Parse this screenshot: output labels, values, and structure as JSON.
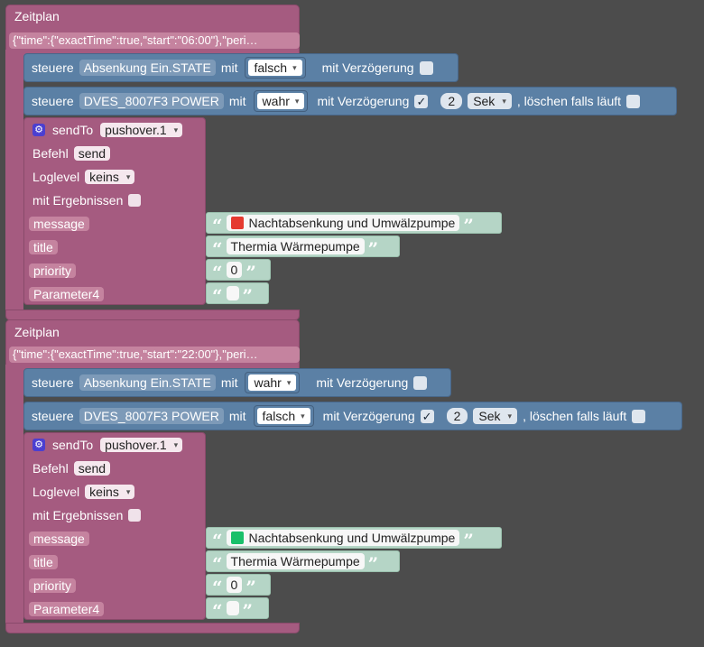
{
  "blocks": [
    {
      "title": "Zeitplan",
      "schedule_arg": "{\"time\":{\"exactTime\":true,\"start\":\"06:00\"},\"peri…",
      "ctrl1": {
        "steuere": "steuere",
        "object": "Absenkung Ein.STATE",
        "mit": "mit",
        "value": "falsch",
        "delay_label": "mit Verzögerung"
      },
      "ctrl2": {
        "steuere": "steuere",
        "object": "DVES_8007F3 POWER",
        "mit": "mit",
        "value": "wahr",
        "delay_label": "mit Verzögerung",
        "check": "✓",
        "delay_value": "2",
        "unit": "Sek",
        "clear_label": ", löschen falls läuft"
      },
      "send": {
        "label": "sendTo",
        "instance": "pushover.1",
        "befehl_label": "Befehl",
        "befehl_value": "send",
        "loglevel_label": "Loglevel",
        "loglevel_value": "keins",
        "ergebnis_label": "mit Ergebnissen",
        "message_label": "message",
        "message_text": "Nachtabsenkung und Umwälzpumpe",
        "message_color": "#e53a2f",
        "title_label": "title",
        "title_text": "Thermia Wärmepumpe",
        "priority_label": "priority",
        "priority_value": "0",
        "param4_label": "Parameter4"
      }
    },
    {
      "title": "Zeitplan",
      "schedule_arg": "{\"time\":{\"exactTime\":true,\"start\":\"22:00\"},\"peri…",
      "ctrl1": {
        "steuere": "steuere",
        "object": "Absenkung Ein.STATE",
        "mit": "mit",
        "value": "wahr",
        "delay_label": "mit Verzögerung"
      },
      "ctrl2": {
        "steuere": "steuere",
        "object": "DVES_8007F3 POWER",
        "mit": "mit",
        "value": "falsch",
        "delay_label": "mit Verzögerung",
        "check": "✓",
        "delay_value": "2",
        "unit": "Sek",
        "clear_label": ", löschen falls läuft"
      },
      "send": {
        "label": "sendTo",
        "instance": "pushover.1",
        "befehl_label": "Befehl",
        "befehl_value": "send",
        "loglevel_label": "Loglevel",
        "loglevel_value": "keins",
        "ergebnis_label": "mit Ergebnissen",
        "message_label": "message",
        "message_text": "Nachtabsenkung und Umwälzpumpe",
        "message_color": "#19c06a",
        "title_label": "title",
        "title_text": "Thermia Wärmepumpe",
        "priority_label": "priority",
        "priority_value": "0",
        "param4_label": "Parameter4"
      }
    }
  ],
  "icons": {
    "caret": "▾",
    "gear": "⚙",
    "open_quote": "“",
    "close_quote": "”"
  }
}
